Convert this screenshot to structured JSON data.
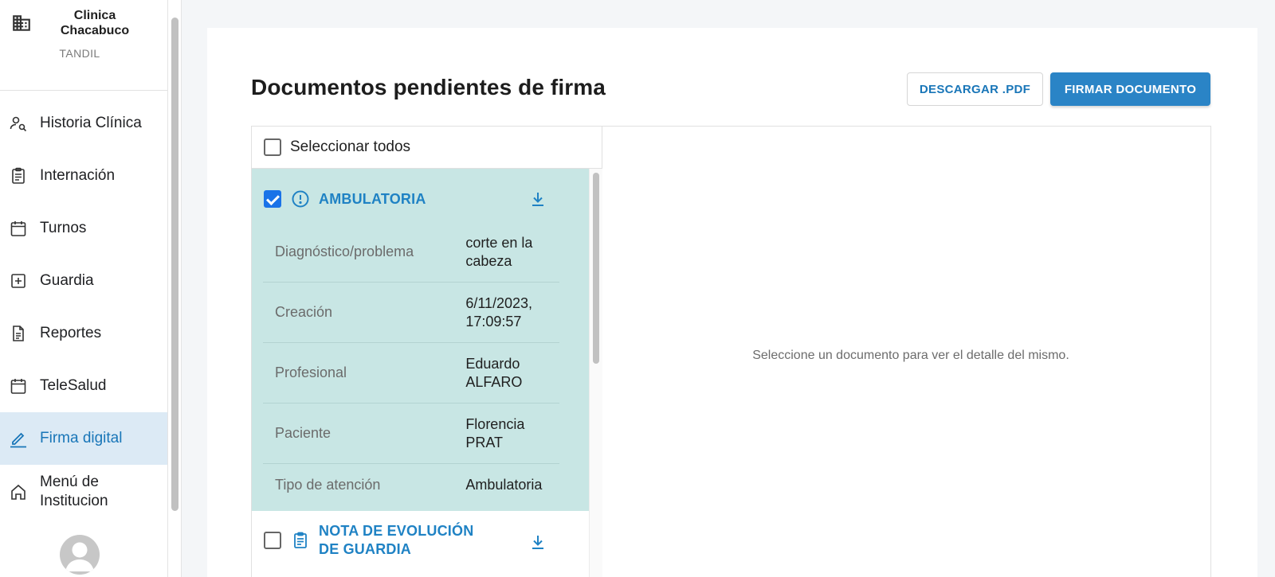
{
  "institution": {
    "name": "Clinica Chacabuco",
    "city": "TANDIL",
    "icon": "building-icon"
  },
  "nav": [
    {
      "label": "Historia Clínica",
      "icon": "person-search-icon",
      "active": false
    },
    {
      "label": "Internación",
      "icon": "clipboard-icon",
      "active": false
    },
    {
      "label": "Turnos",
      "icon": "calendar-icon",
      "active": false
    },
    {
      "label": "Guardia",
      "icon": "plus-square-icon",
      "active": false
    },
    {
      "label": "Reportes",
      "icon": "document-icon",
      "active": false
    },
    {
      "label": "TeleSalud",
      "icon": "calendar-icon",
      "active": false
    },
    {
      "label": "Firma digital",
      "icon": "pen-icon",
      "active": true
    },
    {
      "label": "Menú de Institucion",
      "icon": "home-icon",
      "active": false
    }
  ],
  "header": {
    "title": "Documentos pendientes de firma",
    "download_label": "DESCARGAR .PDF",
    "sign_label": "FIRMAR DOCUMENTO"
  },
  "list": {
    "select_all_label": "Seleccionar todos",
    "select_all_checked": false,
    "documents": [
      {
        "title": "AMBULATORIA",
        "checked": true,
        "icon": "alert-circle-icon",
        "fields": [
          {
            "key": "Diagnóstico/problema",
            "value": "corte en la cabeza"
          },
          {
            "key": "Creación",
            "value": "6/11/2023, 17:09:57"
          },
          {
            "key": "Profesional",
            "value": "Eduardo ALFARO"
          },
          {
            "key": "Paciente",
            "value": "Florencia PRAT"
          },
          {
            "key": "Tipo de atención",
            "value": "Ambulatoria"
          }
        ]
      },
      {
        "title": "NOTA DE EVOLUCIÓN DE GUARDIA",
        "checked": false,
        "icon": "clipboard-icon"
      }
    ]
  },
  "detail": {
    "empty_message": "Seleccione un documento para ver el detalle del mismo."
  },
  "colors": {
    "accent": "#1f82c4",
    "primary_button": "#2a84c6",
    "selected_bg": "#c8e6e4",
    "active_nav_bg": "#dceaf5"
  }
}
